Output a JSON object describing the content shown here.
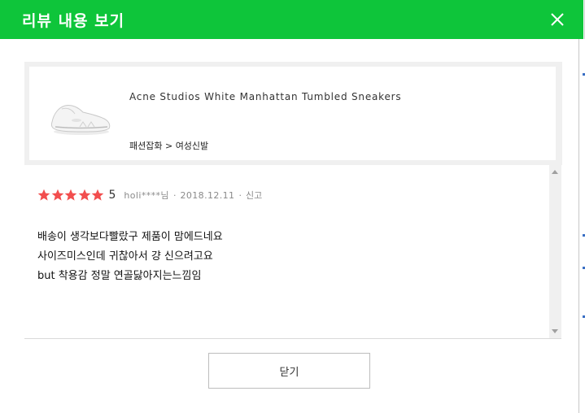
{
  "window": {
    "title": "리뷰 내용 보기",
    "accent_color": "#0ec53a"
  },
  "product": {
    "name": "Acne Studios White Manhattan Tumbled Sneakers",
    "category": "패션잡화 > 여성신발",
    "thumbnail_icon": "white-sneaker-image"
  },
  "review": {
    "stars": 5,
    "max_stars": 5,
    "score": "5",
    "author": "holi****님",
    "date": "2018.12.11",
    "report_label": "신고",
    "star_color": "#f24e4e",
    "lines": [
      "배송이 생각보다빨랐구 제품이 맘에드네요",
      "사이즈미스인데 귀찮아서 걍 신으려고요",
      "but 착용감 정말 연골닳아지는느낌임"
    ]
  },
  "footer": {
    "close_label": "닫기"
  }
}
